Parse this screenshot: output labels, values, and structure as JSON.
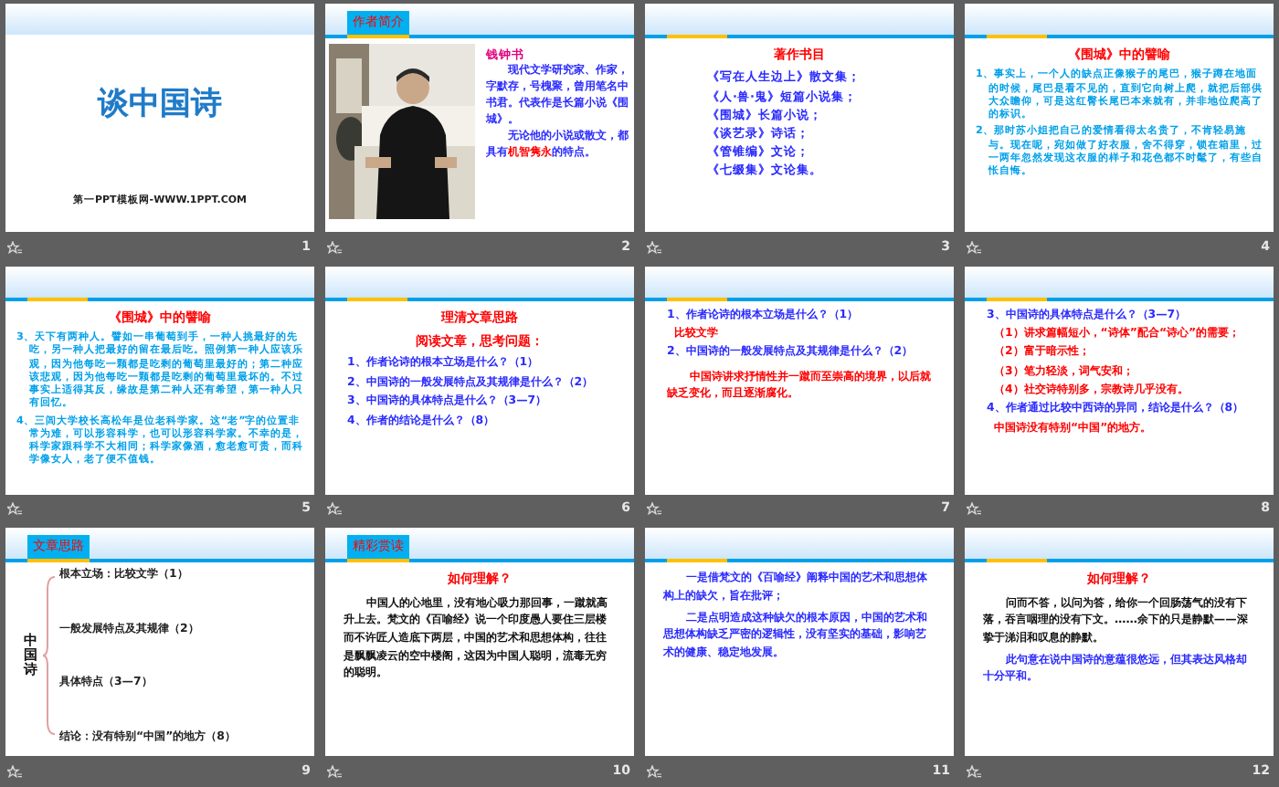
{
  "slides": [
    {
      "number": "1",
      "kind": "cover",
      "accent_line": false,
      "title": "谈中国诗",
      "subtitle": "第一PPT模板网-WWW.1PPT.COM"
    },
    {
      "number": "2",
      "kind": "profile",
      "accent_line": true,
      "tab": "作者简介",
      "name": "钱钟书",
      "blocks": [
        {
          "kind": "point",
          "segments": [
            {
              "text": "现代文学研究家、作家，字默存，号槐聚，曾用笔名中书君。代表作是长篇小说《围城》。",
              "highlight": false
            }
          ]
        },
        {
          "kind": "point",
          "segments": [
            {
              "text": "无论他的小说或散文，都具有",
              "highlight": false
            },
            {
              "text": "机智隽永",
              "highlight": true
            },
            {
              "text": "的特点。",
              "highlight": false
            }
          ]
        }
      ]
    },
    {
      "number": "3",
      "kind": "text",
      "accent_line": true,
      "blocks": [
        {
          "kind": "heading",
          "text": "著作书目"
        },
        {
          "kind": "list",
          "text": "《写在人生边上》散文集；"
        },
        {
          "kind": "list",
          "text": "《人·兽·鬼》短篇小说集；"
        },
        {
          "kind": "list",
          "text": "《围城》长篇小说；"
        },
        {
          "kind": "list",
          "text": "《谈艺录》诗话；"
        },
        {
          "kind": "list",
          "text": "《管锥编》文论；"
        },
        {
          "kind": "list",
          "text": "《七缀集》文论集。"
        }
      ]
    },
    {
      "number": "4",
      "kind": "text",
      "accent_line": true,
      "blocks": [
        {
          "kind": "heading",
          "text": "《围城》中的譬喻"
        },
        {
          "kind": "note",
          "text": "1、事实上，一个人的缺点正像猴子的尾巴，猴子蹲在地面的时候，尾巴是看不见的，直到它向树上爬，就把后部供大众瞻仰，可是这红臀长尾巴本来就有，并非地位爬高了的标识。"
        },
        {
          "kind": "note",
          "text": "2、那时苏小姐把自己的爱情看得太名贵了，不肯轻易施与。现在呢，宛如做了好衣服，舍不得穿，锁在箱里，过一两年忽然发现这衣服的样子和花色都不时髦了，有些自怅自悔。"
        }
      ]
    },
    {
      "number": "5",
      "kind": "text",
      "accent_line": true,
      "blocks": [
        {
          "kind": "heading",
          "text": "《围城》中的譬喻"
        },
        {
          "kind": "note",
          "text": "3、天下有两种人。譬如一串葡萄到手，一种人挑最好的先吃，另一种人把最好的留在最后吃。照例第一种人应该乐观，因为他每吃一颗都是吃剩的葡萄里最好的；第二种应该悲观，因为他每吃一颗都是吃剩的葡萄里最坏的。不过事实上适得其反，缘故是第二种人还有希望，第一种人只有回忆。"
        },
        {
          "kind": "note",
          "text": "4、三闾大学校长高松年是位老科学家。这“老”字的位置非常为难，可以形容科学，也可以形容科学家。不幸的是，科学家跟科学不大相同；科学家像酒，愈老愈可贵，而科学像女人，老了便不值钱。"
        }
      ]
    },
    {
      "number": "6",
      "kind": "text",
      "accent_line": true,
      "blocks": [
        {
          "kind": "heading",
          "text": "理清文章思路"
        },
        {
          "kind": "heading",
          "text": "阅读文章，思考问题："
        },
        {
          "kind": "question",
          "text": "1、作者论诗的根本立场是什么？（1）"
        },
        {
          "kind": "question",
          "text": "2、中国诗的一般发展特点及其规律是什么？（2）"
        },
        {
          "kind": "question",
          "text": "3、中国诗的具体特点是什么？（3—7）"
        },
        {
          "kind": "question",
          "text": "4、作者的结论是什么？（8）"
        }
      ]
    },
    {
      "number": "7",
      "kind": "text",
      "accent_line": true,
      "blocks": [
        {
          "kind": "question",
          "text": "1、作者论诗的根本立场是什么？（1）"
        },
        {
          "kind": "answer",
          "text": "比较文学"
        },
        {
          "kind": "question",
          "text": "2、中国诗的一般发展特点及其规律是什么？（2）"
        },
        {
          "kind": "statement",
          "text": "中国诗讲求抒情性并一蹴而至崇高的境界，以后就缺乏变化，而且逐渐腐化。"
        }
      ]
    },
    {
      "number": "8",
      "kind": "text",
      "accent_line": true,
      "blocks": [
        {
          "kind": "question",
          "text": "3、中国诗的具体特点是什么？（3—7）"
        },
        {
          "kind": "answer",
          "text": "（1）讲求篇幅短小，“诗体”配合“诗心”的需要；"
        },
        {
          "kind": "answer",
          "text": "（2）富于暗示性；"
        },
        {
          "kind": "answer",
          "text": "（3）笔力轻淡，词气安和；"
        },
        {
          "kind": "answer",
          "text": "（4）社交诗特别多，宗教诗几乎没有。"
        },
        {
          "kind": "question",
          "text": "4、作者通过比较中西诗的异同，结论是什么？（8）"
        },
        {
          "kind": "answer",
          "text": "中国诗没有特别“中国”的地方。"
        }
      ]
    },
    {
      "number": "9",
      "kind": "outline",
      "accent_line": true,
      "tab": "文章思路",
      "topic": "中国诗",
      "items": [
        "根本立场：比较文学（1）",
        "一般发展特点及其规律（2）",
        "具体特点（3—7）",
        "结论：没有特别“中国”的地方（8）"
      ]
    },
    {
      "number": "10",
      "kind": "text",
      "accent_line": true,
      "tab": "精彩赏读",
      "blocks": [
        {
          "kind": "heading",
          "text": "如何理解？"
        },
        {
          "kind": "body",
          "text": "中国人的心地里，没有地心吸力那回事，一蹴就高升上去。梵文的《百喻经》说一个印度愚人要住三层楼而不许匠人造底下两层，中国的艺术和思想体构，往往是飘飘凌云的空中楼阁，这因为中国人聪明，流毒无穷的聪明。"
        }
      ]
    },
    {
      "number": "11",
      "kind": "text",
      "accent_line": true,
      "blocks": [
        {
          "kind": "point",
          "text": "一是借梵文的《百喻经》阐释中国的艺术和思想体构上的缺欠，旨在批评；"
        },
        {
          "kind": "point",
          "text": "二是点明造成这种缺欠的根本原因，中国的艺术和思想体构缺乏严密的逻辑性，没有坚实的基础，影响艺术的健康、稳定地发展。"
        }
      ]
    },
    {
      "number": "12",
      "kind": "text",
      "accent_line": true,
      "blocks": [
        {
          "kind": "heading",
          "text": "如何理解？"
        },
        {
          "kind": "body",
          "text": "问而不答，以问为答，给你一个回肠荡气的没有下落，吞言咽理的没有下文。……余下的只是静默——深挚于涕泪和叹息的静默。"
        },
        {
          "kind": "point",
          "text": "此句意在说中国诗的意蕴很悠远，但其表达风格却十分平和。"
        }
      ]
    }
  ]
}
